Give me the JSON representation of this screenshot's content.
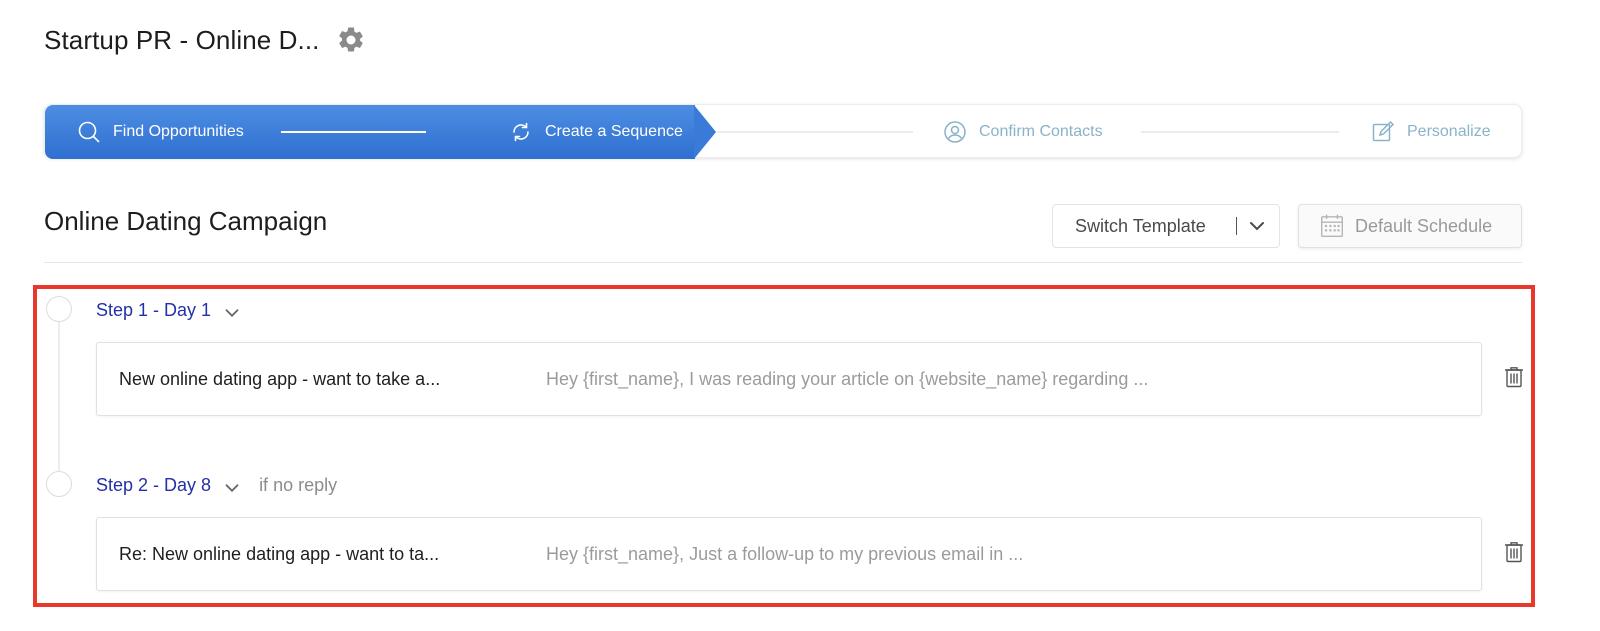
{
  "header": {
    "title": "Startup PR - Online D...",
    "settings_icon": "gear-icon"
  },
  "stepper": {
    "steps": [
      {
        "label": "Find Opportunities",
        "icon": "search-icon",
        "state": "complete"
      },
      {
        "label": "Create a Sequence",
        "icon": "refresh-icon",
        "state": "active"
      },
      {
        "label": "Confirm Contacts",
        "icon": "user-circle-icon",
        "state": "inactive"
      },
      {
        "label": "Personalize",
        "icon": "edit-icon",
        "state": "inactive"
      }
    ],
    "colors": {
      "active": "#3a7bd9",
      "inactive_text": "#8ab3c9"
    }
  },
  "campaign": {
    "title": "Online Dating Campaign",
    "switch_template_label": "Switch Template",
    "default_schedule_label": "Default Schedule"
  },
  "sequence": {
    "steps": [
      {
        "label": "Step 1 - Day 1",
        "condition": "",
        "subject": "New online dating app - want to take a...",
        "preview": "Hey {first_name}, I was reading your article on {website_name} regarding ..."
      },
      {
        "label": "Step 2 - Day 8",
        "condition": "if no reply",
        "subject": "Re: New online dating app - want to ta...",
        "preview": "Hey {first_name}, Just a follow-up to my previous email in ..."
      }
    ]
  },
  "colors": {
    "step_link": "#2330a7",
    "highlight_border": "#e8382b"
  }
}
